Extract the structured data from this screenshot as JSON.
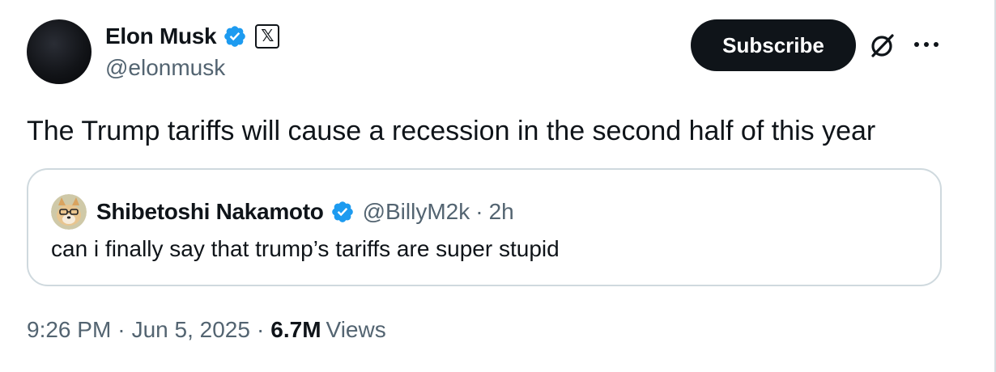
{
  "author": {
    "display_name": "Elon Musk",
    "handle": "@elonmusk",
    "verified_icon": "verified-badge-icon",
    "affiliation_icon": "x-logo-icon",
    "affiliation_glyph": "𝕏"
  },
  "actions": {
    "subscribe_label": "Subscribe",
    "grok_icon": "grok-icon",
    "more_icon": "more-options-icon"
  },
  "tweet": {
    "text": "The Trump tariffs will cause a recession in the second half of this year"
  },
  "quote": {
    "display_name": "Shibetoshi Nakamoto",
    "handle": "@BillyM2k",
    "separator": "·",
    "time": "2h",
    "text": "can i finally say that trump’s tariffs are super stupid"
  },
  "meta": {
    "time": "9:26 PM",
    "separator": "·",
    "date": "Jun 5, 2025",
    "views_count": "6.7M",
    "views_label": "Views"
  },
  "colors": {
    "primary_text": "#0f1419",
    "secondary_text": "#536471",
    "verified_blue": "#1d9bf0",
    "border": "#cfd9de",
    "button_bg": "#0f1419"
  }
}
